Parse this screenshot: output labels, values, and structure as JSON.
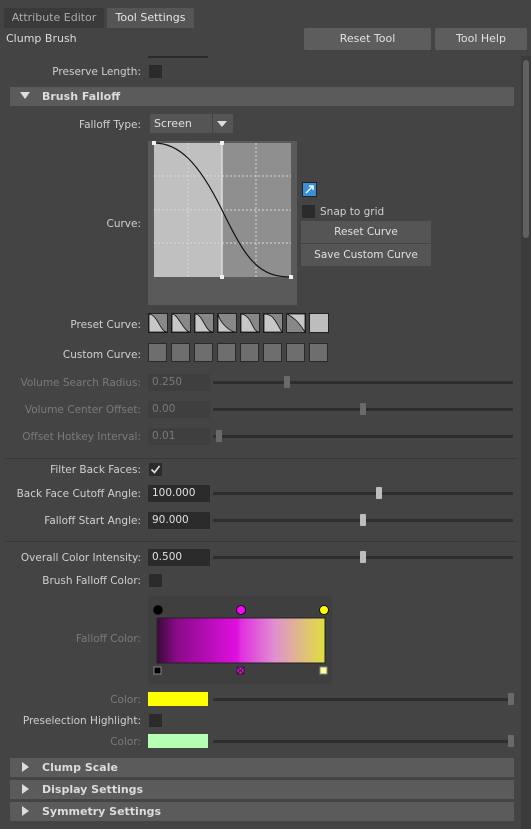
{
  "tabs": [
    {
      "label": "Attribute Editor",
      "active": false
    },
    {
      "label": "Tool Settings",
      "active": true
    }
  ],
  "header": {
    "title": "Clump Brush",
    "reset_label": "Reset Tool",
    "help_label": "Tool Help"
  },
  "preserve_length": {
    "label": "Preserve Length:",
    "checked": false
  },
  "brush_falloff": {
    "title": "Brush Falloff",
    "falloff_type": {
      "label": "Falloff Type:",
      "value": "Screen"
    },
    "curve": {
      "label": "Curve:"
    },
    "snap_to_grid": {
      "label": "Snap to grid",
      "checked": false
    },
    "reset_curve_label": "Reset Curve",
    "save_custom_curve_label": "Save Custom Curve",
    "preset_curve_label": "Preset Curve:",
    "custom_curve_label": "Custom Curve:",
    "volume_search_radius": {
      "label": "Volume Search Radius:",
      "value": "0.250",
      "fraction": 0.25
    },
    "volume_center_offset": {
      "label": "Volume Center Offset:",
      "value": "0.00",
      "fraction": 0.5
    },
    "offset_hotkey_interval": {
      "label": "Offset Hotkey Interval:",
      "value": "0.01",
      "fraction": 0.0
    },
    "filter_back_faces": {
      "label": "Filter Back Faces:",
      "checked": true
    },
    "back_face_cutoff_angle": {
      "label": "Back Face Cutoff Angle:",
      "value": "100.000",
      "fraction": 0.56
    },
    "falloff_start_angle": {
      "label": "Falloff Start Angle:",
      "value": "90.000",
      "fraction": 0.5
    },
    "overall_color_intensity": {
      "label": "Overall Color Intensity:",
      "value": "0.500",
      "fraction": 0.5
    },
    "brush_falloff_color": {
      "label": "Brush Falloff Color:",
      "checked": false
    },
    "falloff_color": {
      "label": "Falloff Color:",
      "stops": [
        "#000000",
        "#ff00ff",
        "#ffff00"
      ]
    },
    "color1": {
      "label": "Color:",
      "swatch": "#ffff00"
    },
    "preselection_highlight": {
      "label": "Preselection Highlight:",
      "checked": false
    },
    "color2": {
      "label": "Color:",
      "swatch": "#b4ffb4"
    }
  },
  "sections": [
    {
      "label": "Clump Scale"
    },
    {
      "label": "Display Settings"
    },
    {
      "label": "Symmetry Settings"
    }
  ],
  "colors": {
    "accent_magenta": "#ff00ff",
    "accent_yellow": "#ffff00",
    "check_mark": "#e0e0e0"
  }
}
